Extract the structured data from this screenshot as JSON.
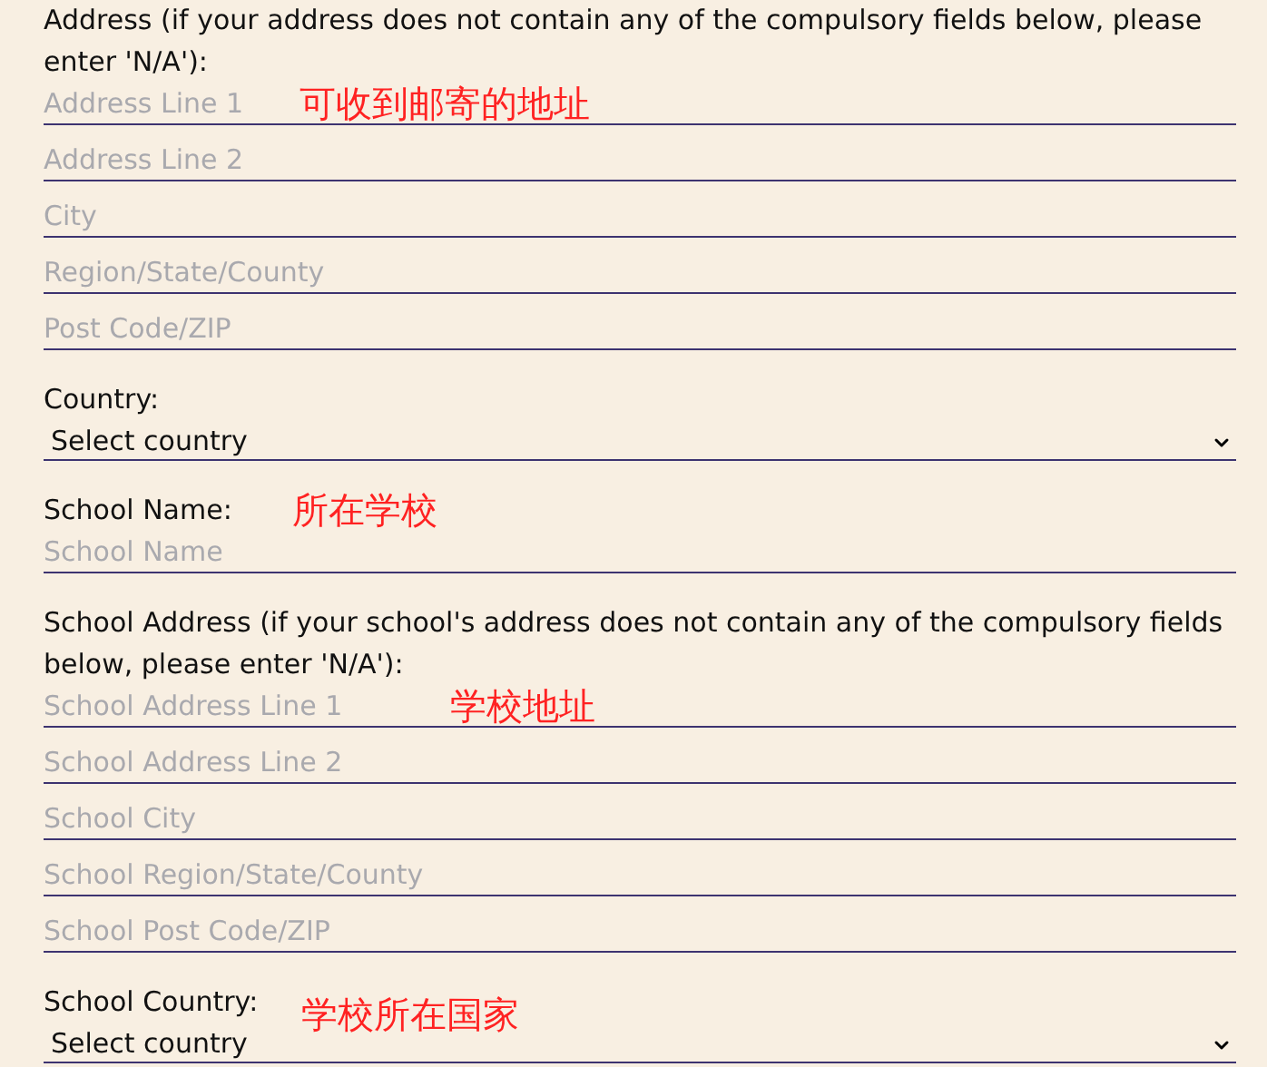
{
  "sections": [
    {
      "kind": "fields",
      "label": "Address (if your address does not contain any of the compulsory fields below, please enter 'N/A'):",
      "note": "可收到邮寄的地址",
      "fields": [
        {
          "placeholder": "Address Line 1"
        },
        {
          "placeholder": "Address Line 2"
        },
        {
          "placeholder": "City"
        },
        {
          "placeholder": "Region/State/County"
        },
        {
          "placeholder": "Post Code/ZIP"
        }
      ]
    },
    {
      "kind": "select",
      "label": "Country:",
      "value": "Select country"
    },
    {
      "kind": "fields",
      "label": "School Name:",
      "note": "所在学校",
      "fields": [
        {
          "placeholder": "School Name"
        }
      ]
    },
    {
      "kind": "fields",
      "label": "School Address (if your school's address does not contain any of the compulsory fields below, please enter 'N/A'):",
      "note": "学校地址",
      "fields": [
        {
          "placeholder": "School Address Line 1"
        },
        {
          "placeholder": "School Address Line 2"
        },
        {
          "placeholder": "School City"
        },
        {
          "placeholder": "School Region/State/County"
        },
        {
          "placeholder": "School Post Code/ZIP"
        }
      ]
    },
    {
      "kind": "select",
      "label": "School Country:",
      "value": "Select country",
      "note": "学校所在国家"
    }
  ]
}
